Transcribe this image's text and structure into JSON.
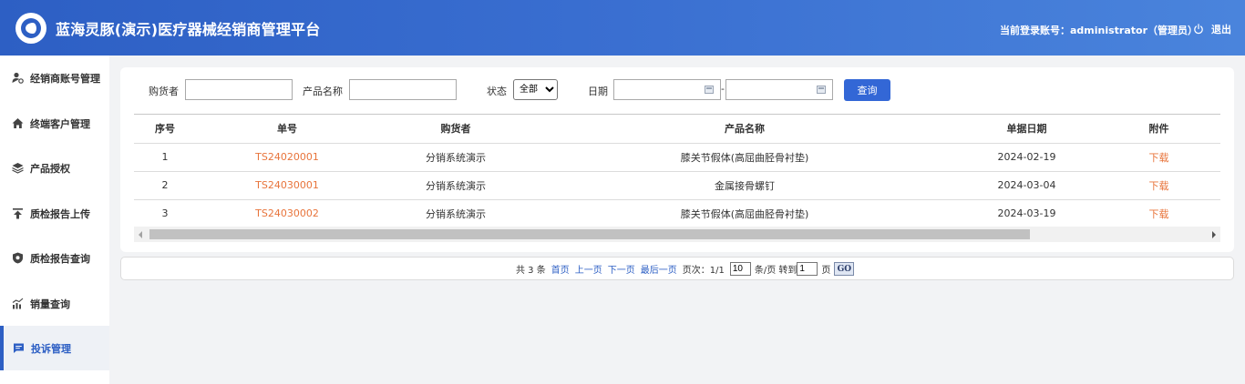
{
  "header": {
    "app_title": "蓝海灵豚(演示)医疗器械经销商管理平台",
    "account_text": "当前登录账号：administrator（管理员）",
    "logout_label": "退出"
  },
  "sidebar": {
    "items": [
      {
        "label": "经销商账号管理",
        "icon": "user-settings-icon"
      },
      {
        "label": "终端客户管理",
        "icon": "home-icon"
      },
      {
        "label": "产品授权",
        "icon": "layers-icon"
      },
      {
        "label": "质检报告上传",
        "icon": "upload-icon"
      },
      {
        "label": "质检报告查询",
        "icon": "shield-icon"
      },
      {
        "label": "销量查询",
        "icon": "chart-icon"
      },
      {
        "label": "投诉管理",
        "icon": "message-icon"
      }
    ],
    "active_index": 6
  },
  "filters": {
    "buyer_label": "购货者",
    "buyer_value": "",
    "product_label": "产品名称",
    "product_value": "",
    "status_label": "状态",
    "status_value": "全部",
    "date_label": "日期",
    "date_sep": "-",
    "query_label": "查询"
  },
  "table": {
    "headers": [
      "序号",
      "单号",
      "购货者",
      "产品名称",
      "单据日期",
      "附件"
    ],
    "rows": [
      {
        "index": "1",
        "order_no": "TS24020001",
        "buyer": "分销系统演示",
        "product": "膝关节假体(高屈曲胫骨衬垫)",
        "date": "2024-02-19",
        "attachment": "下载"
      },
      {
        "index": "2",
        "order_no": "TS24030001",
        "buyer": "分销系统演示",
        "product": "金属接骨螺钉",
        "date": "2024-03-04",
        "attachment": "下载"
      },
      {
        "index": "3",
        "order_no": "TS24030002",
        "buyer": "分销系统演示",
        "product": "膝关节假体(高屈曲胫骨衬垫)",
        "date": "2024-03-19",
        "attachment": "下载"
      }
    ]
  },
  "pager": {
    "total_text": "共 3 条",
    "first": "首页",
    "prev": "上一页",
    "next": "下一页",
    "last": "最后一页",
    "page_info": "页次：1/1",
    "page_size": "10",
    "per_page_text": "条/页 转到",
    "jump_value": "1",
    "page_unit": "页",
    "go_label": "GO"
  },
  "colors": {
    "header_start": "#2d5fc4",
    "header_end": "#4a84dc",
    "link_orange": "#e8743b",
    "link_blue": "#2d5fc4",
    "button_blue": "#3367d6"
  }
}
